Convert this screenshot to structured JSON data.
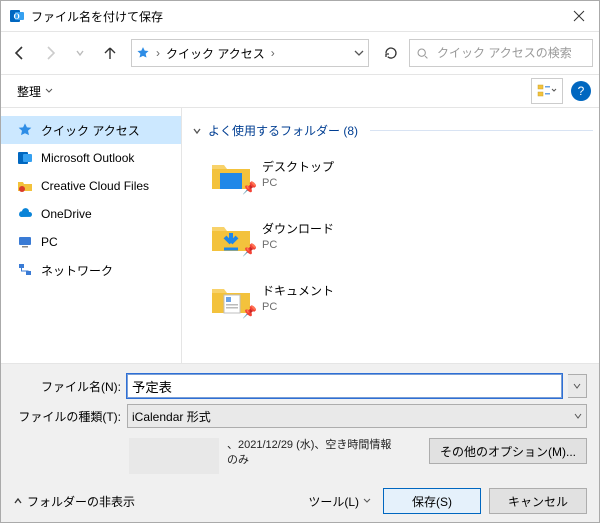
{
  "title": "ファイル名を付けて保存",
  "nav": {
    "location": "クイック アクセス",
    "search_placeholder": "クイック アクセスの検索"
  },
  "toolbar": {
    "organize": "整理"
  },
  "sidebar": {
    "items": [
      {
        "label": "クイック アクセス"
      },
      {
        "label": "Microsoft Outlook"
      },
      {
        "label": "Creative Cloud Files"
      },
      {
        "label": "OneDrive"
      },
      {
        "label": "PC"
      },
      {
        "label": "ネットワーク"
      }
    ]
  },
  "content": {
    "group_label": "よく使用するフォルダー (8)",
    "items": [
      {
        "name": "デスクトップ",
        "sub": "PC"
      },
      {
        "name": "ダウンロード",
        "sub": "PC"
      },
      {
        "name": "ドキュメント",
        "sub": "PC"
      }
    ]
  },
  "fields": {
    "filename_label": "ファイル名(N):",
    "filename_value": "予定表",
    "filetype_label": "ファイルの種類(T):",
    "filetype_value": "iCalendar 形式"
  },
  "preview_text": "、2021/12/29 (水)、空き時間情報のみ",
  "more_options": "その他のオプション(M)...",
  "footer": {
    "hide_folders": "フォルダーの非表示",
    "tools": "ツール(L)",
    "save": "保存(S)",
    "cancel": "キャンセル"
  }
}
